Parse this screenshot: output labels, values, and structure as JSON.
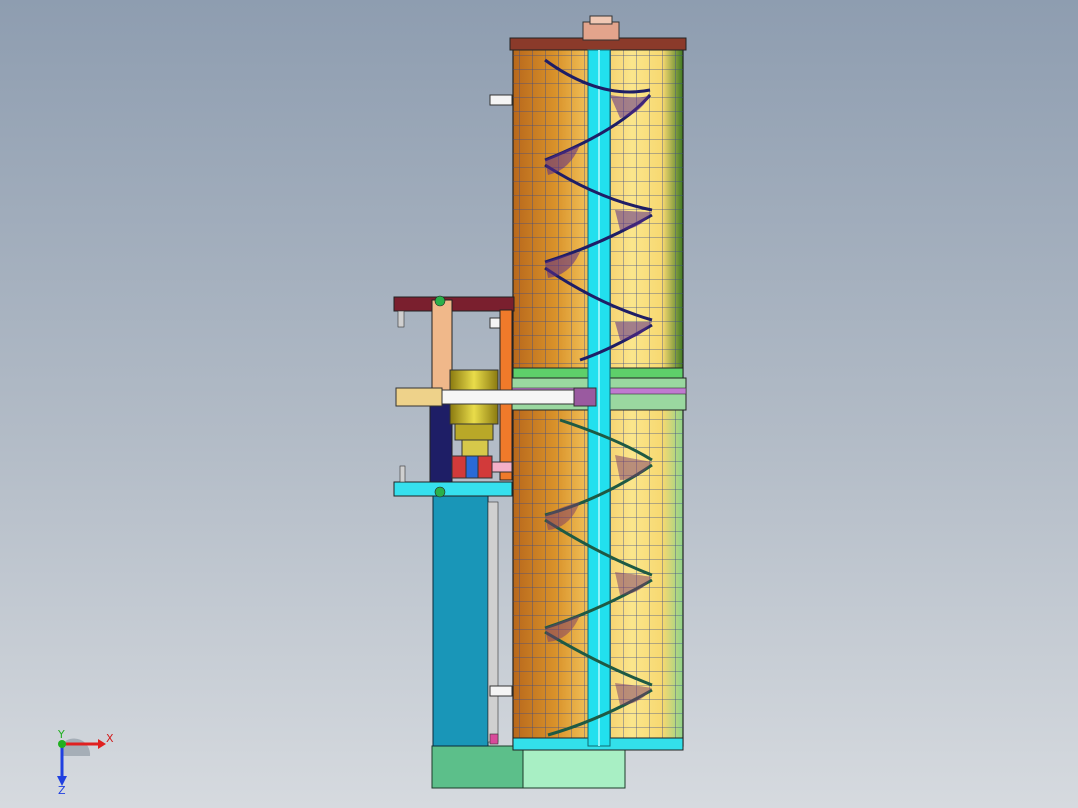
{
  "viewport": {
    "background_top": "#8e9db0",
    "background_bottom": "#d6dadf"
  },
  "model": {
    "description_color_shell": "#d9922a",
    "auger_color": "#2a2a6e",
    "shaft_color": "#22e0ee",
    "frame_color": "#7a1f2e",
    "base_color": "#5cbf8a"
  },
  "triad": {
    "x_label": "X",
    "y_label": "Y",
    "z_label": "Z",
    "x_color": "#e02020",
    "y_color": "#20b020",
    "z_color": "#2040e0"
  }
}
